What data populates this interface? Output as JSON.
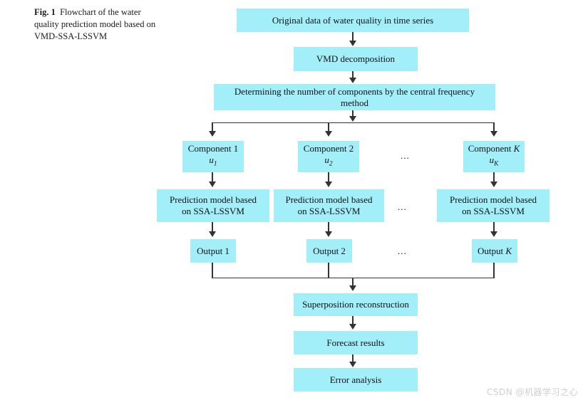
{
  "figure": {
    "label": "Fig. 1",
    "caption": "Flowchart of the water quality prediction model based on VMD-SSA-LSSVM"
  },
  "style": {
    "box_fill": "#a2effa",
    "line_color": "#333333",
    "text_color": "#111111",
    "background": "#ffffff",
    "watermark_color": "#cfcfcf"
  },
  "flowchart": {
    "type": "flowchart",
    "orientation": "top-to-bottom",
    "nodes": {
      "original_data": "Original data of water quality in time series",
      "vmd": "VMD decomposition",
      "determining_line1": "Determining the number of components by the central frequency",
      "determining_line2": "method",
      "component_1_title": "Component 1",
      "component_1_sub": "u",
      "component_1_subscript": "1",
      "component_2_title": "Component 2",
      "component_2_sub": "u",
      "component_2_subscript": "2",
      "component_k_title_prefix": "Component ",
      "component_k_title_italic": "K",
      "component_k_sub": "u",
      "component_k_subscript": "K",
      "prediction_line1": "Prediction model based",
      "prediction_line2": "on SSA-LSSVM",
      "output_1": "Output 1",
      "output_2": "Output 2",
      "output_k_prefix": "Output ",
      "output_k_italic": "K",
      "superposition": "Superposition reconstruction",
      "forecast": "Forecast results",
      "error": "Error analysis"
    },
    "ellipsis": "...",
    "branch_count_label": "K"
  },
  "watermark": {
    "text": "CSDN @机器学习之心"
  }
}
